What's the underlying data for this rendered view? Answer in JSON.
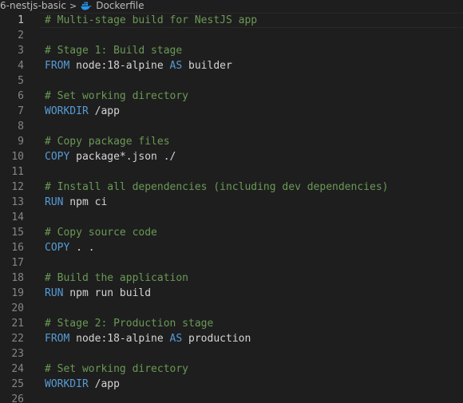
{
  "breadcrumb": {
    "folder": "6-nestjs-basic",
    "separator": ">",
    "file": "Dockerfile"
  },
  "colors": {
    "background": "#1e1e1e",
    "comment": "#6a9955",
    "keyword": "#569cd6",
    "plain": "#d4d4d4",
    "line_number": "#858585",
    "docker_icon": "#2496ed"
  },
  "editor": {
    "current_line": 1,
    "lines": [
      {
        "number": "1",
        "tokens": [
          {
            "type": "comment",
            "text": "# Multi-stage build for NestJS app"
          }
        ]
      },
      {
        "number": "2",
        "tokens": []
      },
      {
        "number": "3",
        "tokens": [
          {
            "type": "comment",
            "text": "# Stage 1: Build stage"
          }
        ]
      },
      {
        "number": "4",
        "tokens": [
          {
            "type": "keyword",
            "text": "FROM"
          },
          {
            "type": "plain",
            "text": " node:18-alpine "
          },
          {
            "type": "keyword",
            "text": "AS"
          },
          {
            "type": "plain",
            "text": " builder"
          }
        ]
      },
      {
        "number": "5",
        "tokens": []
      },
      {
        "number": "6",
        "tokens": [
          {
            "type": "comment",
            "text": "# Set working directory"
          }
        ]
      },
      {
        "number": "7",
        "tokens": [
          {
            "type": "keyword",
            "text": "WORKDIR"
          },
          {
            "type": "plain",
            "text": " /app"
          }
        ]
      },
      {
        "number": "8",
        "tokens": []
      },
      {
        "number": "9",
        "tokens": [
          {
            "type": "comment",
            "text": "# Copy package files"
          }
        ]
      },
      {
        "number": "10",
        "tokens": [
          {
            "type": "keyword",
            "text": "COPY"
          },
          {
            "type": "plain",
            "text": " package*.json ./"
          }
        ]
      },
      {
        "number": "11",
        "tokens": []
      },
      {
        "number": "12",
        "tokens": [
          {
            "type": "comment",
            "text": "# Install all dependencies (including dev dependencies)"
          }
        ]
      },
      {
        "number": "13",
        "tokens": [
          {
            "type": "keyword",
            "text": "RUN"
          },
          {
            "type": "plain",
            "text": " npm ci"
          }
        ]
      },
      {
        "number": "14",
        "tokens": []
      },
      {
        "number": "15",
        "tokens": [
          {
            "type": "comment",
            "text": "# Copy source code"
          }
        ]
      },
      {
        "number": "16",
        "tokens": [
          {
            "type": "keyword",
            "text": "COPY"
          },
          {
            "type": "plain",
            "text": " . ."
          }
        ]
      },
      {
        "number": "17",
        "tokens": []
      },
      {
        "number": "18",
        "tokens": [
          {
            "type": "comment",
            "text": "# Build the application"
          }
        ]
      },
      {
        "number": "19",
        "tokens": [
          {
            "type": "keyword",
            "text": "RUN"
          },
          {
            "type": "plain",
            "text": " npm run build"
          }
        ]
      },
      {
        "number": "20",
        "tokens": []
      },
      {
        "number": "21",
        "tokens": [
          {
            "type": "comment",
            "text": "# Stage 2: Production stage"
          }
        ]
      },
      {
        "number": "22",
        "tokens": [
          {
            "type": "keyword",
            "text": "FROM"
          },
          {
            "type": "plain",
            "text": " node:18-alpine "
          },
          {
            "type": "keyword",
            "text": "AS"
          },
          {
            "type": "plain",
            "text": " production"
          }
        ]
      },
      {
        "number": "23",
        "tokens": []
      },
      {
        "number": "24",
        "tokens": [
          {
            "type": "comment",
            "text": "# Set working directory"
          }
        ]
      },
      {
        "number": "25",
        "tokens": [
          {
            "type": "keyword",
            "text": "WORKDIR"
          },
          {
            "type": "plain",
            "text": " /app"
          }
        ]
      },
      {
        "number": "26",
        "tokens": []
      }
    ]
  },
  "icons": {
    "file_icon": "docker-icon"
  }
}
